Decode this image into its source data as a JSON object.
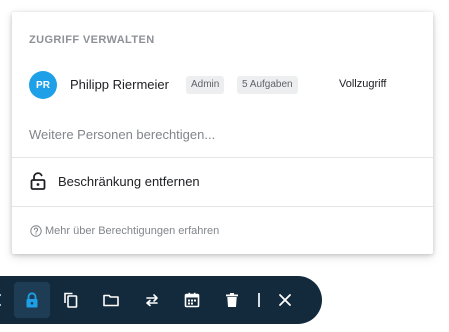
{
  "popover": {
    "title": "ZUGRIFF VERWALTEN",
    "user": {
      "initials": "PR",
      "name": "Philipp Riermeier",
      "tags": [
        "Admin",
        "5 Aufgaben"
      ],
      "access_level": "Vollzugriff",
      "avatar_color": "#1ea0e8"
    },
    "invite_placeholder": "Weitere Personen berechtigen...",
    "invite_value": "",
    "remove_restriction_label": "Beschränkung entfernen",
    "help_link": "Mehr über Berechtigungen erfahren"
  },
  "toolbar": {
    "background": "#132a3d",
    "active_color": "#1ea0e8",
    "buttons": [
      {
        "name": "lock-icon",
        "active": true
      },
      {
        "name": "copy-icon",
        "active": false
      },
      {
        "name": "folder-icon",
        "active": false
      },
      {
        "name": "swap-arrows-icon",
        "active": false
      },
      {
        "name": "calendar-icon",
        "active": false
      },
      {
        "name": "trash-icon",
        "active": false
      },
      {
        "name": "close-icon",
        "active": false
      }
    ]
  }
}
